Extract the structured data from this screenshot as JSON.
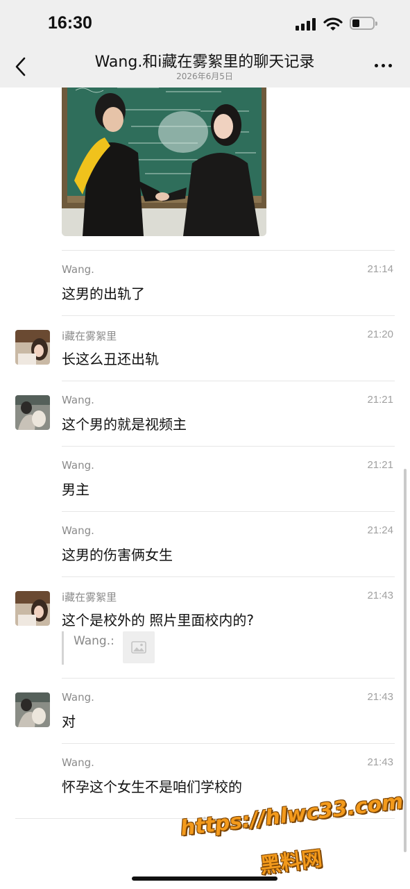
{
  "status_bar": {
    "time": "16:30"
  },
  "header": {
    "title": "Wang.和i藏在雾絮里的聊天记录",
    "date": "2026年6月5日",
    "back_icon": "chevron-left-icon",
    "more_icon": "more-dots-icon"
  },
  "shared_image": {
    "icon": "photo-graduation-handshake"
  },
  "messages": [
    {
      "sender": "Wang.",
      "time": "21:14",
      "text": "这男的出轨了",
      "show_avatar": false
    },
    {
      "sender": "i藏在雾絮里",
      "time": "21:20",
      "text": "长这么丑还出轨",
      "show_avatar": true
    },
    {
      "sender": "Wang.",
      "time": "21:21",
      "text": "这个男的就是视频主",
      "show_avatar": true
    },
    {
      "sender": "Wang.",
      "time": "21:21",
      "text": "男主",
      "show_avatar": false
    },
    {
      "sender": "Wang.",
      "time": "21:24",
      "text": "这男的伤害俩女生",
      "show_avatar": false
    },
    {
      "sender": "i藏在雾絮里",
      "time": "21:43",
      "text": "这个是校外的 照片里面校内的?",
      "show_avatar": true,
      "quote": {
        "label": "Wang.:",
        "thumb_icon": "image-placeholder-icon"
      }
    },
    {
      "sender": "Wang.",
      "time": "21:43",
      "text": "对",
      "show_avatar": true
    },
    {
      "sender": "Wang.",
      "time": "21:43",
      "text": "怀孕这个女生不是咱们学校的",
      "show_avatar": false
    }
  ],
  "watermark": {
    "url": "https://hlwc33.com",
    "name": "黑料网"
  },
  "colors": {
    "header_bg": "#efefef",
    "watermark": "#f39a1c"
  }
}
